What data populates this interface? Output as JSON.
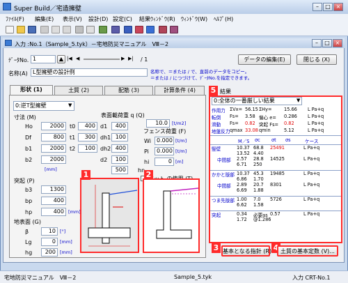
{
  "app": {
    "title": "Super Build／宅造擁壁"
  },
  "menu": [
    "ﾌｧｲﾙ(F)",
    "編集(E)",
    "表示(V)",
    "設計(D)",
    "設定(C)",
    "結果ｳｨﾝﾄﾞｳ(R)",
    "ｳｨﾝﾄﾞｳ(W)",
    "ﾍﾙﾌﾟ(H)"
  ],
  "window": {
    "title": "入力 :No.1（Sample_5.tyk）－宅地防災マニュアル　Ⅷ－2"
  },
  "dataNo": {
    "label": "ﾃﾞｰﾀNo.",
    "value": "1",
    "total": "/ 1"
  },
  "buttons": {
    "edit_data": "データの編集(E)",
    "close": "閉じる (X)",
    "basic_index": "基本となる指針 (R)...",
    "soil_const": "土質の基本定数 (V)..."
  },
  "name": {
    "label": "名称(A)",
    "value": "L型擁壁の設計例",
    "hint1": "名称で、＝または / で、直前のデータをコピー。",
    "hint2": "＝または / につづけて、ﾃﾞｰﾀNo.を指定できます。"
  },
  "tabs": [
    "形状 (1)",
    "土質 (2)",
    "配筋 (3)",
    "計算条件 (4)"
  ],
  "shape": {
    "type_select": "0:逆T型擁壁",
    "dims_label": "寸法 (M)",
    "dims": [
      {
        "name": "Ho",
        "value": "2000"
      },
      {
        "name": "Df",
        "value": "800"
      },
      {
        "name": "b1",
        "value": "2000"
      },
      {
        "name": "b2",
        "value": "2000"
      }
    ],
    "dims_t": [
      {
        "name": "t0",
        "value": "400"
      },
      {
        "name": "t1",
        "value": "300"
      },
      {
        "name": "t2",
        "value": "100"
      }
    ],
    "dims_d": [
      {
        "name": "d1",
        "value": "400"
      },
      {
        "name": "dh1",
        "value": "100"
      },
      {
        "name": "dh2",
        "value": "400"
      },
      {
        "name": "d2",
        "value": "100"
      }
    ],
    "hn": {
      "name": "hn",
      "value": "500"
    },
    "mm": "[mm]",
    "surface_load": {
      "label": "表面載荷重 q (Q)",
      "value": "10.0",
      "unit": "[t/m2]"
    },
    "fence_label": "フェンス荷重 (F)",
    "fence": [
      {
        "name": "Wi",
        "value": "0.000",
        "unit": "[t/m]"
      },
      {
        "name": "Pi",
        "value": "0.000",
        "unit": "[t/m]"
      },
      {
        "name": "hi",
        "value": "0",
        "unit": "[m]"
      }
    ],
    "mat_label": "マット の使用 (T)",
    "protrusion_label": "突起 (P)",
    "protrusion": [
      {
        "name": "b3",
        "value": "1300"
      },
      {
        "name": "bp",
        "value": "400"
      },
      {
        "name": "hp",
        "value": "400"
      }
    ],
    "ground_label": "地表面 (G)",
    "ground": [
      {
        "name": "β",
        "value": "10",
        "unit": "[°]"
      },
      {
        "name": "Lg",
        "value": "0",
        "unit": "[mm]"
      },
      {
        "name": "hg",
        "value": "200",
        "unit": "[mm]"
      }
    ]
  },
  "results": {
    "title": "結果",
    "select": "0:全体の一番厳しい結果",
    "rows": [
      [
        "作用力",
        "ΣVx=",
        "56.15",
        "ΣHy=",
        "15.66",
        "L Pa+q"
      ],
      [
        "転倒",
        "Fs=",
        "3.58",
        "偏心 e=",
        "0.286",
        "L Pa+q"
      ],
      [
        "滑動",
        "Fs=",
        "0.82",
        "突起 Fs=",
        "0.82",
        "L Pa+q"
      ],
      [
        "地盤反力",
        "qmax",
        "33.08",
        "qmin",
        "5.12",
        "L Pa+q"
      ]
    ],
    "header": [
      "M／S",
      "σc",
      "σt",
      "σs",
      "ケース"
    ],
    "sections": [
      {
        "name": "竪壁",
        "lines": [
          [
            "",
            "10.37",
            "68.8",
            "25491",
            "L Pa+q"
          ],
          [
            "",
            "13.52",
            "4.40",
            "",
            ""
          ],
          [
            "中間部",
            "2.57",
            "28.8",
            "14525",
            "L Pa+q"
          ],
          [
            "",
            "6.71",
            "250",
            "",
            ""
          ]
        ]
      },
      {
        "name": "かかと版部",
        "lines": [
          [
            "",
            "10.37",
            "45.3",
            "19485",
            "L Pa+q"
          ],
          [
            "",
            "6.86",
            "1.70",
            "",
            ""
          ],
          [
            "中間部",
            "2.89",
            "20.7",
            "8301",
            "L Pa+q"
          ],
          [
            "",
            "6.69",
            "1.88",
            "",
            ""
          ]
        ]
      },
      {
        "name": "つま先版部",
        "lines": [
          [
            "",
            "1.00",
            "7.0",
            "5726",
            "L Pa+q"
          ],
          [
            "",
            "6.62",
            "1.58",
            "",
            ""
          ]
        ]
      },
      {
        "name": "突起",
        "lines": [
          [
            "",
            "0.34",
            "必要as",
            "0.57",
            "L Pa+q"
          ],
          [
            "",
            "1.72",
            "@1.286",
            "",
            ""
          ]
        ]
      }
    ]
  },
  "status": {
    "left": "宅地防災マニュアル　Ⅷ－2",
    "mid": "Sample_5.tyk",
    "right": "入力 CRT-No.1"
  },
  "badges": [
    "1",
    "2",
    "3",
    "4",
    "5"
  ],
  "colors": {
    "accent": "#ff2a2a",
    "hint": "#0000cc"
  }
}
